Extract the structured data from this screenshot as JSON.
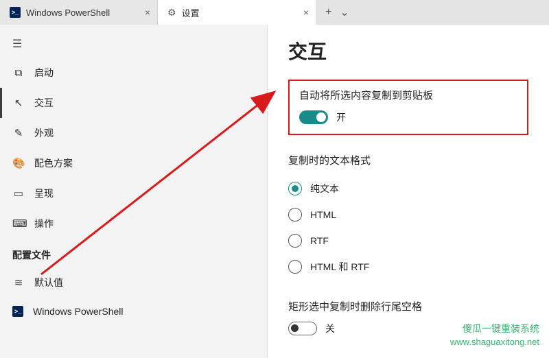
{
  "tabs": {
    "powershell": "Windows PowerShell",
    "settings": "设置"
  },
  "sidebar": {
    "items": [
      {
        "icon": "⧉",
        "label": "启动"
      },
      {
        "icon": "↖",
        "label": "交互"
      },
      {
        "icon": "✎",
        "label": "外观"
      },
      {
        "icon": "🎨",
        "label": "配色方案"
      },
      {
        "icon": "▭",
        "label": "呈现"
      },
      {
        "icon": "⌨",
        "label": "操作"
      }
    ],
    "section": "配置文件",
    "profiles": [
      {
        "icon": "layers",
        "label": "默认值"
      },
      {
        "icon": "ps",
        "label": "Windows PowerShell"
      }
    ]
  },
  "content": {
    "heading": "交互",
    "copy_clipboard": {
      "title": "自动将所选内容复制到剪贴板",
      "state_on": "开"
    },
    "text_format": {
      "title": "复制时的文本格式",
      "options": [
        "纯文本",
        "HTML",
        "RTF",
        "HTML 和 RTF"
      ]
    },
    "trim_whitespace": {
      "title": "矩形选中复制时删除行尾空格",
      "state_off": "关"
    }
  },
  "watermark": {
    "line1": "傻瓜一键重装系统",
    "line2": "www.shaguaxitong.net"
  }
}
